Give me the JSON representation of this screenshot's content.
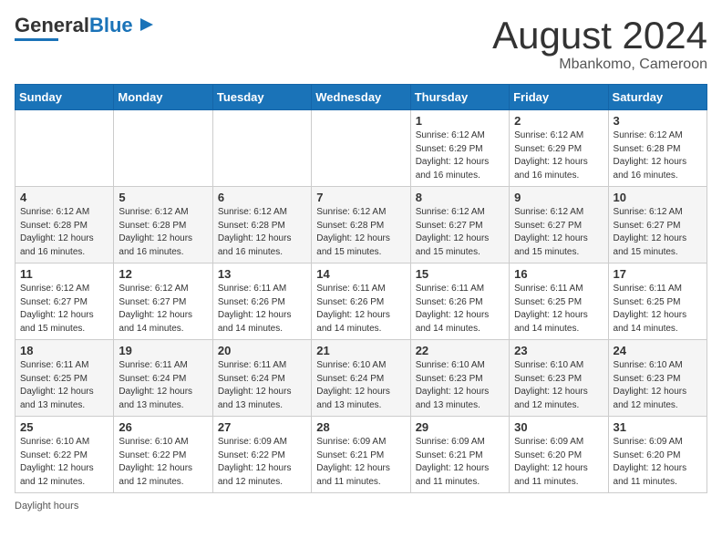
{
  "header": {
    "logo_line1": "General",
    "logo_line2": "Blue",
    "main_title": "August 2024",
    "subtitle": "Mbankomo, Cameroon"
  },
  "days_of_week": [
    "Sunday",
    "Monday",
    "Tuesday",
    "Wednesday",
    "Thursday",
    "Friday",
    "Saturday"
  ],
  "weeks": [
    [
      {
        "day": "",
        "info": ""
      },
      {
        "day": "",
        "info": ""
      },
      {
        "day": "",
        "info": ""
      },
      {
        "day": "",
        "info": ""
      },
      {
        "day": "1",
        "info": "Sunrise: 6:12 AM\nSunset: 6:29 PM\nDaylight: 12 hours and 16 minutes."
      },
      {
        "day": "2",
        "info": "Sunrise: 6:12 AM\nSunset: 6:29 PM\nDaylight: 12 hours and 16 minutes."
      },
      {
        "day": "3",
        "info": "Sunrise: 6:12 AM\nSunset: 6:28 PM\nDaylight: 12 hours and 16 minutes."
      }
    ],
    [
      {
        "day": "4",
        "info": "Sunrise: 6:12 AM\nSunset: 6:28 PM\nDaylight: 12 hours and 16 minutes."
      },
      {
        "day": "5",
        "info": "Sunrise: 6:12 AM\nSunset: 6:28 PM\nDaylight: 12 hours and 16 minutes."
      },
      {
        "day": "6",
        "info": "Sunrise: 6:12 AM\nSunset: 6:28 PM\nDaylight: 12 hours and 16 minutes."
      },
      {
        "day": "7",
        "info": "Sunrise: 6:12 AM\nSunset: 6:28 PM\nDaylight: 12 hours and 15 minutes."
      },
      {
        "day": "8",
        "info": "Sunrise: 6:12 AM\nSunset: 6:27 PM\nDaylight: 12 hours and 15 minutes."
      },
      {
        "day": "9",
        "info": "Sunrise: 6:12 AM\nSunset: 6:27 PM\nDaylight: 12 hours and 15 minutes."
      },
      {
        "day": "10",
        "info": "Sunrise: 6:12 AM\nSunset: 6:27 PM\nDaylight: 12 hours and 15 minutes."
      }
    ],
    [
      {
        "day": "11",
        "info": "Sunrise: 6:12 AM\nSunset: 6:27 PM\nDaylight: 12 hours and 15 minutes."
      },
      {
        "day": "12",
        "info": "Sunrise: 6:12 AM\nSunset: 6:27 PM\nDaylight: 12 hours and 14 minutes."
      },
      {
        "day": "13",
        "info": "Sunrise: 6:11 AM\nSunset: 6:26 PM\nDaylight: 12 hours and 14 minutes."
      },
      {
        "day": "14",
        "info": "Sunrise: 6:11 AM\nSunset: 6:26 PM\nDaylight: 12 hours and 14 minutes."
      },
      {
        "day": "15",
        "info": "Sunrise: 6:11 AM\nSunset: 6:26 PM\nDaylight: 12 hours and 14 minutes."
      },
      {
        "day": "16",
        "info": "Sunrise: 6:11 AM\nSunset: 6:25 PM\nDaylight: 12 hours and 14 minutes."
      },
      {
        "day": "17",
        "info": "Sunrise: 6:11 AM\nSunset: 6:25 PM\nDaylight: 12 hours and 14 minutes."
      }
    ],
    [
      {
        "day": "18",
        "info": "Sunrise: 6:11 AM\nSunset: 6:25 PM\nDaylight: 12 hours and 13 minutes."
      },
      {
        "day": "19",
        "info": "Sunrise: 6:11 AM\nSunset: 6:24 PM\nDaylight: 12 hours and 13 minutes."
      },
      {
        "day": "20",
        "info": "Sunrise: 6:11 AM\nSunset: 6:24 PM\nDaylight: 12 hours and 13 minutes."
      },
      {
        "day": "21",
        "info": "Sunrise: 6:10 AM\nSunset: 6:24 PM\nDaylight: 12 hours and 13 minutes."
      },
      {
        "day": "22",
        "info": "Sunrise: 6:10 AM\nSunset: 6:23 PM\nDaylight: 12 hours and 13 minutes."
      },
      {
        "day": "23",
        "info": "Sunrise: 6:10 AM\nSunset: 6:23 PM\nDaylight: 12 hours and 12 minutes."
      },
      {
        "day": "24",
        "info": "Sunrise: 6:10 AM\nSunset: 6:23 PM\nDaylight: 12 hours and 12 minutes."
      }
    ],
    [
      {
        "day": "25",
        "info": "Sunrise: 6:10 AM\nSunset: 6:22 PM\nDaylight: 12 hours and 12 minutes."
      },
      {
        "day": "26",
        "info": "Sunrise: 6:10 AM\nSunset: 6:22 PM\nDaylight: 12 hours and 12 minutes."
      },
      {
        "day": "27",
        "info": "Sunrise: 6:09 AM\nSunset: 6:22 PM\nDaylight: 12 hours and 12 minutes."
      },
      {
        "day": "28",
        "info": "Sunrise: 6:09 AM\nSunset: 6:21 PM\nDaylight: 12 hours and 11 minutes."
      },
      {
        "day": "29",
        "info": "Sunrise: 6:09 AM\nSunset: 6:21 PM\nDaylight: 12 hours and 11 minutes."
      },
      {
        "day": "30",
        "info": "Sunrise: 6:09 AM\nSunset: 6:20 PM\nDaylight: 12 hours and 11 minutes."
      },
      {
        "day": "31",
        "info": "Sunrise: 6:09 AM\nSunset: 6:20 PM\nDaylight: 12 hours and 11 minutes."
      }
    ]
  ],
  "footer": {
    "daylight_label": "Daylight hours"
  }
}
